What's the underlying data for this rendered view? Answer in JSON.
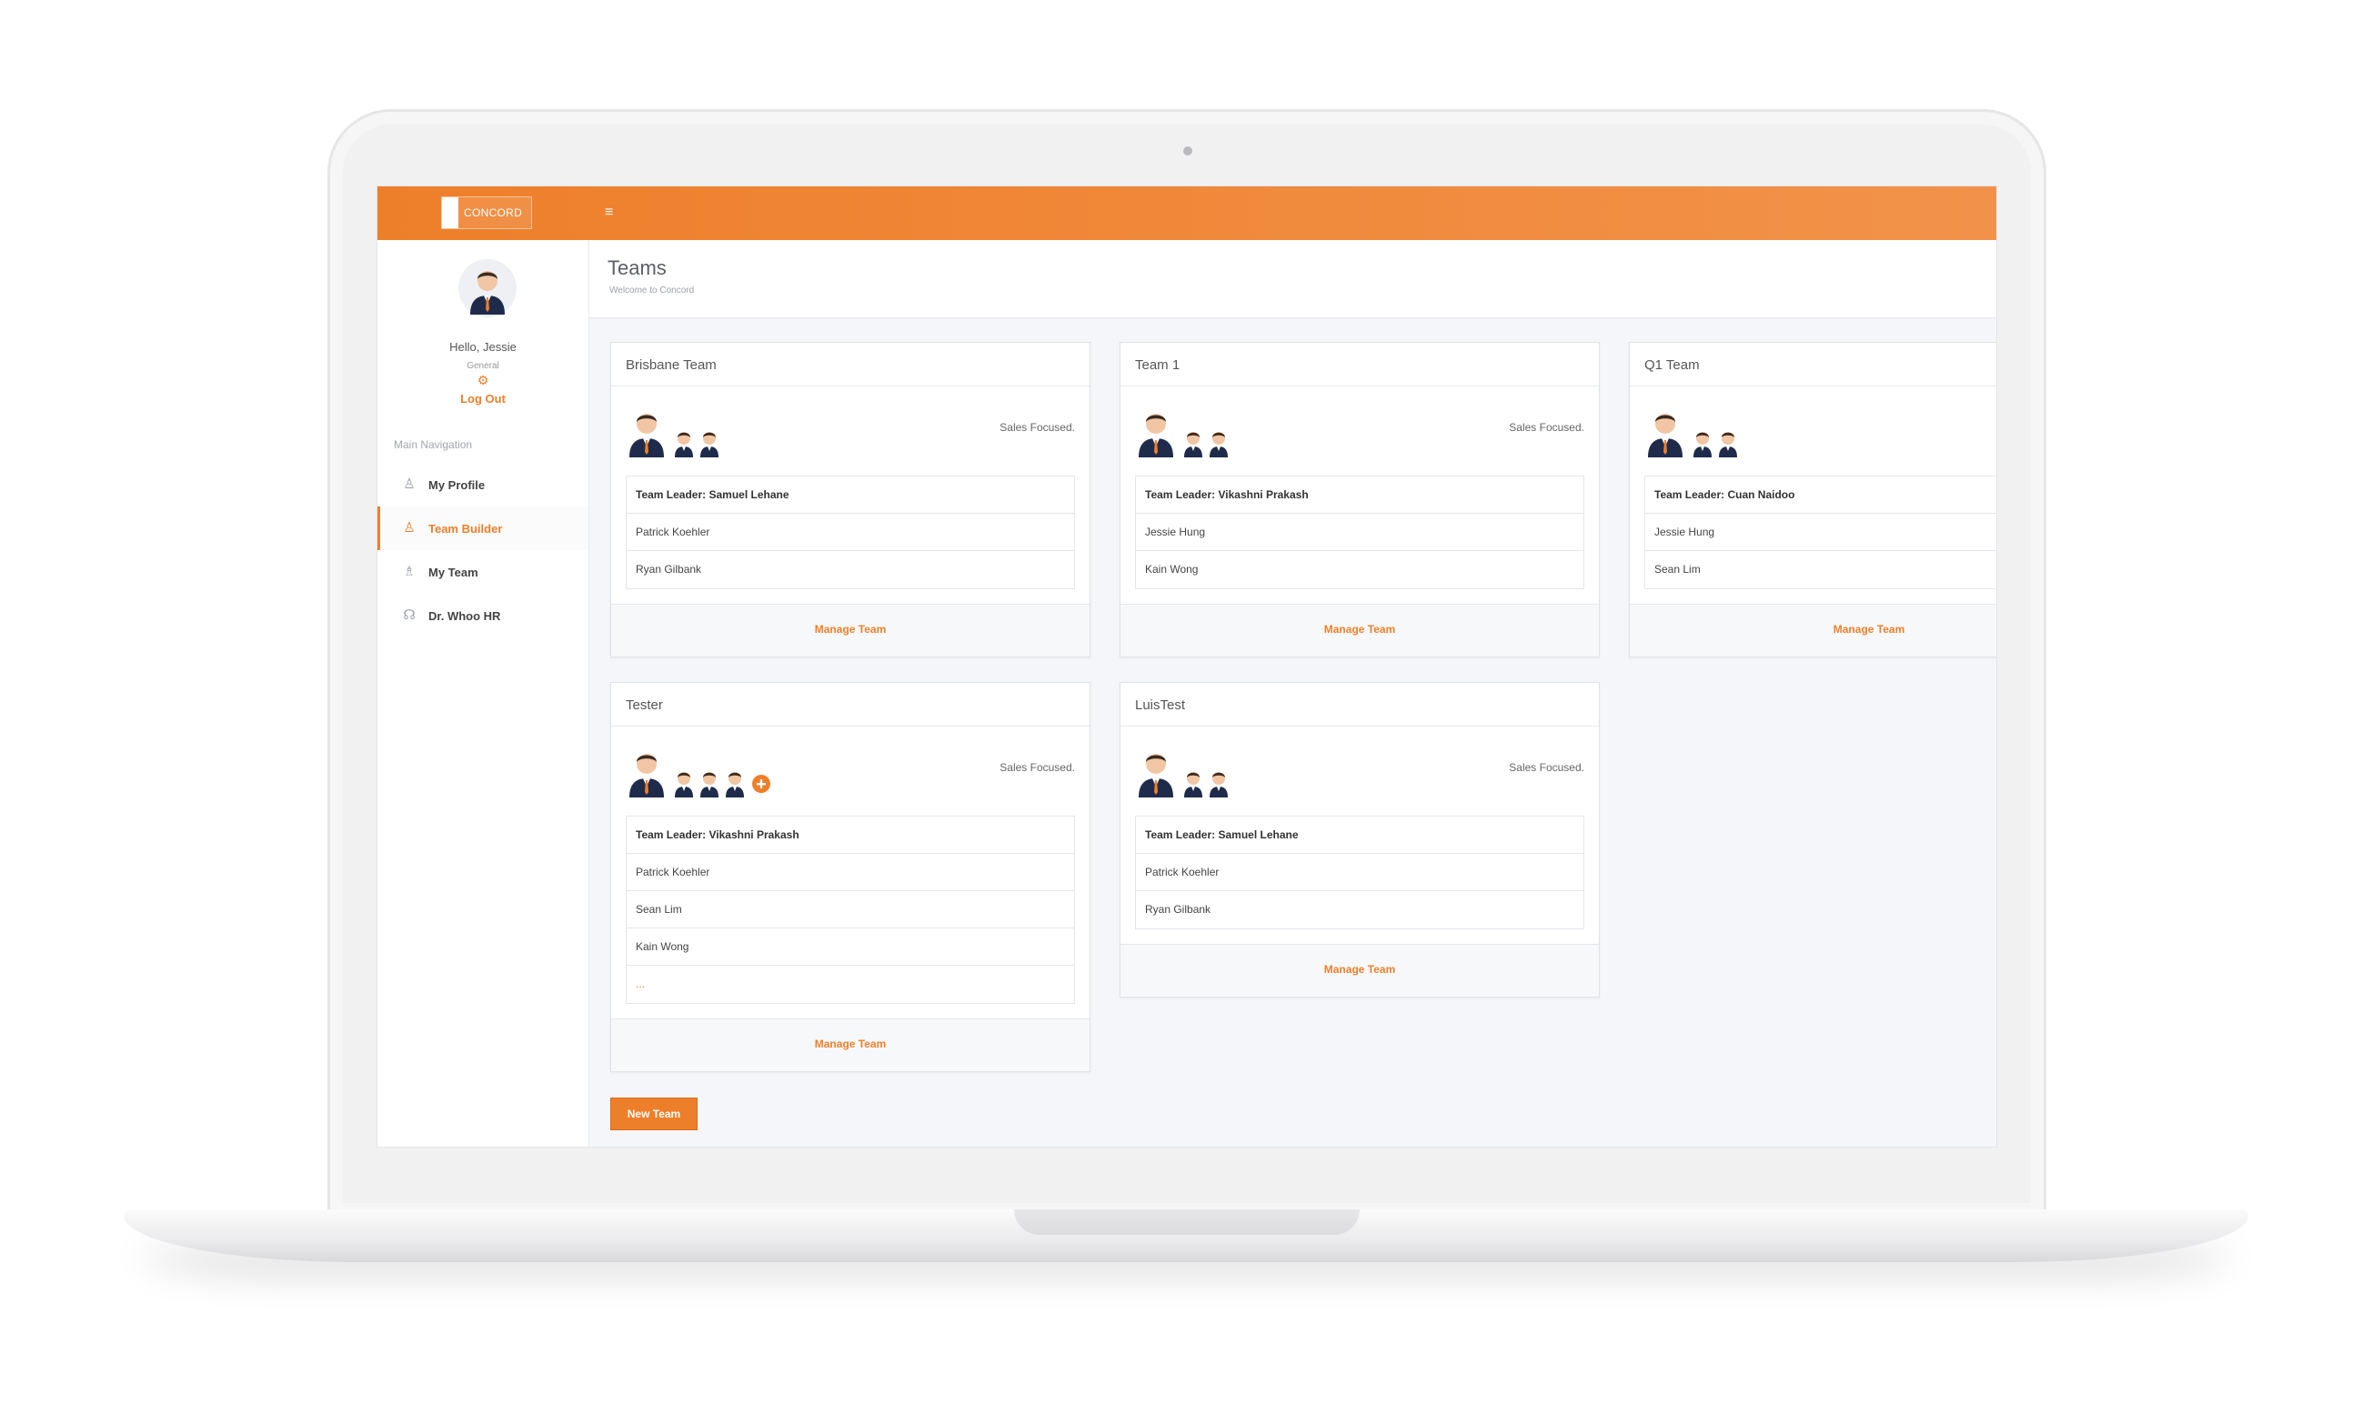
{
  "colors": {
    "accent": "#ee7f2a",
    "navy": "#1f2b4a"
  },
  "brand": {
    "name": "CONCORD"
  },
  "user": {
    "greeting": "Hello, Jessie",
    "role": "General",
    "logout": "Log Out"
  },
  "sidebar": {
    "heading": "Main Navigation",
    "items": [
      {
        "label": "My Profile",
        "icon": "person-icon"
      },
      {
        "label": "Team Builder",
        "icon": "team-builder-icon",
        "active": true
      },
      {
        "label": "My Team",
        "icon": "group-icon"
      },
      {
        "label": "Dr. Whoo HR",
        "icon": "headset-icon"
      }
    ]
  },
  "page": {
    "title": "Teams",
    "subtitle": "Welcome to Concord"
  },
  "teams": [
    {
      "name": "Brisbane Team",
      "focus": "Sales Focused.",
      "leader": "Team Leader: Samuel Lehane",
      "members": [
        "Patrick Koehler",
        "Ryan Gilbank"
      ],
      "manage": "Manage Team"
    },
    {
      "name": "Team 1",
      "focus": "Sales Focused.",
      "leader": "Team Leader: Vikashni Prakash",
      "members": [
        "Jessie Hung",
        "Kain Wong"
      ],
      "manage": "Manage Team"
    },
    {
      "name": "Q1 Team",
      "focus": "",
      "leader": "Team Leader: Cuan Naidoo",
      "members": [
        "Jessie Hung",
        "Sean Lim"
      ],
      "manage": "Manage Team"
    },
    {
      "name": "Tester",
      "focus": "Sales Focused.",
      "leader": "Team Leader: Vikashni Prakash",
      "members": [
        "Patrick Koehler",
        "Sean Lim",
        "Kain Wong"
      ],
      "more": "...",
      "manage": "Manage Team"
    },
    {
      "name": "LuisTest",
      "focus": "Sales Focused.",
      "leader": "Team Leader: Samuel Lehane",
      "members": [
        "Patrick Koehler",
        "Ryan Gilbank"
      ],
      "manage": "Manage Team"
    }
  ],
  "actions": {
    "new_team": "New Team"
  }
}
